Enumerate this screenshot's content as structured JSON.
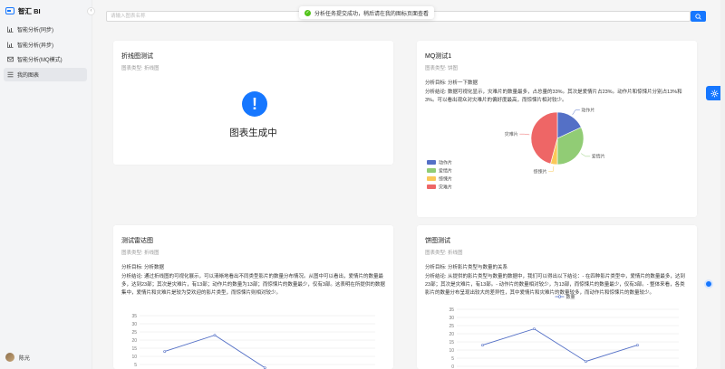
{
  "app": {
    "title": "智汇 BI"
  },
  "sidebar": {
    "items": [
      {
        "label": "智能分析(同步)",
        "icon": "bar-chart-icon"
      },
      {
        "label": "智能分析(异步)",
        "icon": "bar-chart-icon"
      },
      {
        "label": "智能分析(MQ模式)",
        "icon": "mail-icon"
      },
      {
        "label": "我的图表",
        "icon": "list-icon",
        "active": true
      }
    ],
    "user": {
      "name": "陈光"
    }
  },
  "search": {
    "placeholder": "请输入图表名称"
  },
  "toast": {
    "text": "分析任务提交成功，稍后请在我的图标页面查看"
  },
  "cards": [
    {
      "title": "折线图测试",
      "chart_type": "图表类型: 折线图",
      "status_text": "图表生成中"
    },
    {
      "title": "MQ测试1",
      "chart_type": "图表类型: 饼图",
      "goal": "分析目标: 分析一下数据",
      "conclusion": "分析结论: 数据可视化显示，灾难片的数量最多，占总量的33%。其次是爱情片占23%。动作片和惊悚片分别占13%和3%。可以看出观众对灾难片的偏好度最高，而惊悚片相对较少。"
    },
    {
      "title": "测试雷达图",
      "chart_type": "图表类型: 折线图",
      "goal": "分析目标: 分析数据",
      "conclusion": "分析结论: 通过折线图的可视化展示，可以清晰地看出不同类型影片的数量分布情况。从图中可以看出，爱情片的数量最多，达到23部；其次是灾难片，有13部；动作片的数量为13部；而惊悚片的数量最少，仅有3部。这表明在所提供的数据集中，爱情片和灾难片是较为受欢迎的影片类型，而惊悚片则相对较少。"
    },
    {
      "title": "饼图测试",
      "chart_type": "图表类型: 折线图",
      "goal": "分析目标: 分析影片类型与数量的关系",
      "conclusion": "分析结论: 从提供的影片类型与数量的数据中，我们可以得出以下结论：- 在四种影片类型中，爱情片的数量最多，达到23部；其次是灾难片，有13部。- 动作片的数量相对较少，为13部，而惊悚片的数量最少，仅有3部。- 整体来看，各类影片的数量分布呈现出较大的差异性，其中爱情片和灾难片的数量较多，而动作片和惊悚片的数量较少。"
    }
  ],
  "chart_data": [
    {
      "type": "pie",
      "categories": [
        "动作片",
        "爱情片",
        "惊悚片",
        "灾难片"
      ],
      "values": [
        13,
        23,
        3,
        33
      ],
      "colors": [
        "#5470c6",
        "#91cc75",
        "#fac858",
        "#ee6666"
      ],
      "legend_position": "bottom-left"
    },
    {
      "type": "line",
      "title": "",
      "ylim": [
        0,
        35
      ],
      "yticks": [
        0,
        5,
        10,
        15,
        20,
        25,
        30,
        35
      ],
      "values": [
        13,
        23,
        3
      ],
      "color": "#5470c6",
      "grid": true
    },
    {
      "type": "line",
      "title": "",
      "ylim": [
        0,
        35
      ],
      "yticks": [
        0,
        5,
        10,
        15,
        20,
        25,
        30,
        35
      ],
      "series": [
        {
          "name": "数量",
          "values": [
            13,
            23,
            3,
            13
          ]
        }
      ],
      "color": "#5470c6",
      "legend_position": "top-center",
      "grid": true
    }
  ]
}
